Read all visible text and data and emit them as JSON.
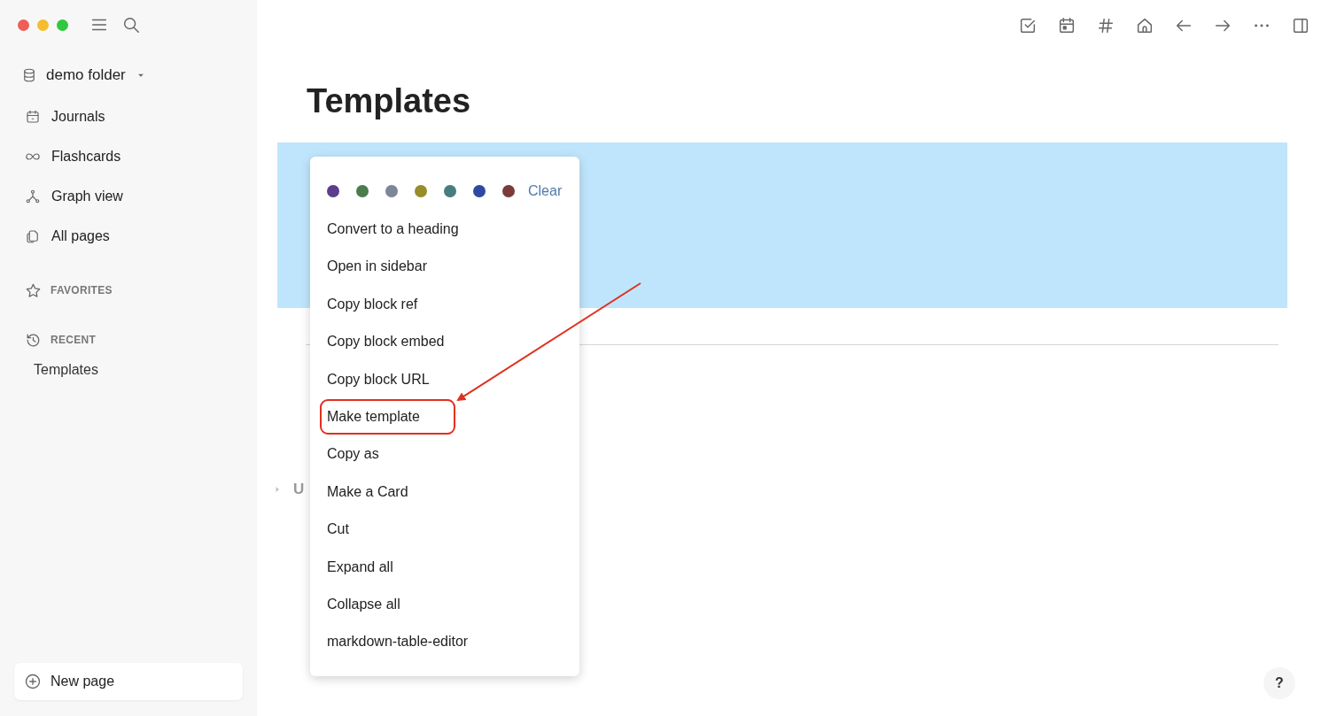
{
  "sidebar": {
    "workspace": "demo folder",
    "nav": [
      {
        "label": "Journals",
        "kind": "calendar"
      },
      {
        "label": "Flashcards",
        "kind": "infinity"
      },
      {
        "label": "Graph view",
        "kind": "graph"
      },
      {
        "label": "All pages",
        "kind": "pages"
      }
    ],
    "sections": [
      {
        "label": "FAVORITES",
        "kind": "favorites"
      },
      {
        "label": "RECENT",
        "kind": "recent",
        "items": [
          "Templates"
        ]
      }
    ],
    "new_page": "New page"
  },
  "page": {
    "title": "Templates",
    "selected_block": {
      "selected": true
    },
    "heading": {
      "text": "U",
      "expanded": false
    }
  },
  "context_menu": {
    "colors": [
      {
        "color": "#5b3e8c"
      },
      {
        "color": "#4a7d4e"
      },
      {
        "color": "#7d8599"
      },
      {
        "color": "#978d2a"
      },
      {
        "color": "#467e80"
      },
      {
        "color": "#2d4aa0"
      },
      {
        "color": "#7a3b3a"
      }
    ],
    "clear": "Clear",
    "items": [
      {
        "label": "Convert to a heading",
        "annotated": false
      },
      {
        "label": "Open in sidebar",
        "annotated": false
      },
      {
        "label": "Copy block ref",
        "annotated": false
      },
      {
        "label": "Copy block embed",
        "annotated": false
      },
      {
        "label": "Copy block URL",
        "annotated": false
      },
      {
        "label": "Make template",
        "annotated": true
      },
      {
        "label": "Copy as",
        "annotated": false
      },
      {
        "label": "Make a Card",
        "annotated": false
      },
      {
        "label": "Cut",
        "annotated": false
      },
      {
        "label": "Expand all",
        "annotated": false
      },
      {
        "label": "Collapse all",
        "annotated": false
      },
      {
        "label": "markdown-table-editor",
        "annotated": false
      }
    ]
  },
  "help": "?"
}
